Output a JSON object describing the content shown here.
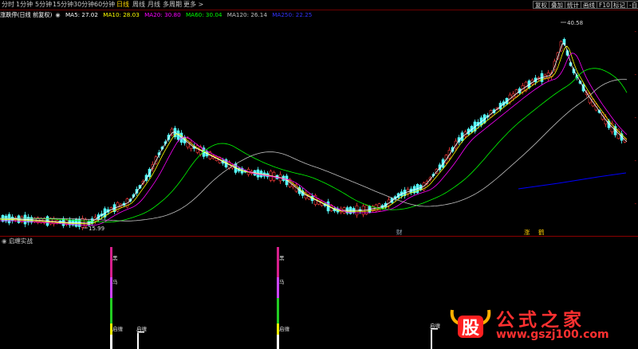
{
  "toolbar": {
    "periods": [
      "分时",
      "1分钟",
      "5分钟",
      "15分钟",
      "30分钟",
      "60分钟",
      "日线",
      "周线",
      "月线",
      "多周期",
      "更多 >"
    ],
    "active_index": 6,
    "right_buttons": [
      "复权",
      "叠加",
      "统计",
      "画线",
      "F10",
      "标记",
      "-自"
    ]
  },
  "info": {
    "title": "涨跌停(日线 前复权)",
    "ma5": "MA5: 27.02",
    "ma10": "MA10: 28.03",
    "ma20": "MA20: 30.80",
    "ma60": "MA60: 30.04",
    "ma120": "MA120: 26.14",
    "ma250": "MA250: 22.25"
  },
  "colors": {
    "up": "#ff3b3b",
    "up_fill": "#000000",
    "down": "#55ffff",
    "ma5": "#ffffff",
    "ma10": "#ffff00",
    "ma20": "#ff00ff",
    "ma60": "#00ff00",
    "ma120": "#c0c0c0",
    "ma250": "#0000ff"
  },
  "annotations": {
    "high_label": "40.58",
    "low_label": "15.99",
    "event1": "财",
    "event2": "涨",
    "event3": "鹤"
  },
  "right_ticks": [
    "-",
    "-",
    "-",
    "-",
    "-"
  ],
  "sub": {
    "title": "启缠实战",
    "bar1_labels": [
      "黑",
      "马",
      "启缠"
    ],
    "bar2_labels": [
      "黑",
      "马",
      "启缠"
    ],
    "small_labels": [
      "启缠",
      "启缠"
    ]
  },
  "watermark": {
    "logo_char": "股",
    "title": "公式之家",
    "url": "www.gszj100.com"
  }
}
